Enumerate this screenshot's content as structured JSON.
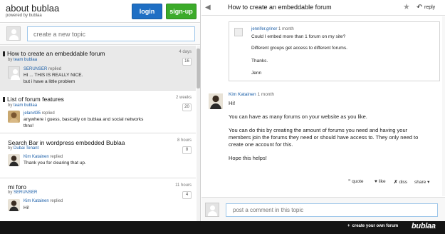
{
  "forum": {
    "title": "about bublaa",
    "powered_by": "powered by bublaa",
    "login_label": "login",
    "signup_label": "sign-up",
    "new_topic_placeholder": "create a new topic"
  },
  "topics": [
    {
      "title": "How to create an embeddable forum",
      "by": "by",
      "author": "team bublaa",
      "time": "4 days",
      "count": "16",
      "reply_user": "SERUNSER",
      "reply_verb": "replied",
      "reply_lines": [
        "HI ... THIS IS REALLY NICE.",
        "but i have a little problem"
      ]
    },
    {
      "title": "List of forum features",
      "by": "by",
      "author": "team bublaa",
      "time": "2 weeks",
      "count": "20",
      "reply_user": "jelani435",
      "reply_verb": "replied",
      "reply_lines": [
        "anywhere i guess, basically on bublaa and social networks",
        "thnx!"
      ]
    },
    {
      "title": "Search Bar in wordpress embedded Bublaa",
      "by": "by",
      "author": "Dubai Tenant",
      "time": "8 hours",
      "count": "8",
      "reply_user": "Kim Katainen",
      "reply_verb": "replied",
      "reply_lines": [
        "Thank you for clearing that up."
      ]
    },
    {
      "title": "mi foro",
      "by": "by",
      "author": "SERUNSER",
      "time": "11 hours",
      "count": "4",
      "reply_user": "Kim Katainen",
      "reply_verb": "replied",
      "reply_lines": [
        "Hi!"
      ]
    }
  ],
  "thread": {
    "title": "How to create an embeddable forum",
    "reply_label": "reply",
    "quoted": {
      "author": "jennifer.griner",
      "time": "1 month",
      "lines": [
        "Could I embed more than 1 forum on my site?",
        "Different groups get access to different forums.",
        "Thanks.",
        "Jenn"
      ]
    },
    "post": {
      "author": "Kim Katainen",
      "time": "1 month",
      "lines": [
        "Hi!",
        "You can have as many forums on your website as you like.",
        "You can do this by creating the amount of forums you need and having your",
        "members join the forums they need or should have access to. They only need to",
        "create one account for this.",
        "Hope this helps!"
      ]
    },
    "actions": {
      "quote": "quote",
      "like": "like",
      "diss": "diss",
      "share": "share"
    },
    "comment_placeholder": "post a comment in this topic"
  },
  "footer": {
    "create_forum": "create your own forum",
    "logo": "bublaa"
  },
  "colors": {
    "login": "#1f6fc4",
    "signup": "#3cab2a",
    "link": "#1a5ea8",
    "active_topic": "#e9e9e9",
    "footer": "#141414"
  }
}
